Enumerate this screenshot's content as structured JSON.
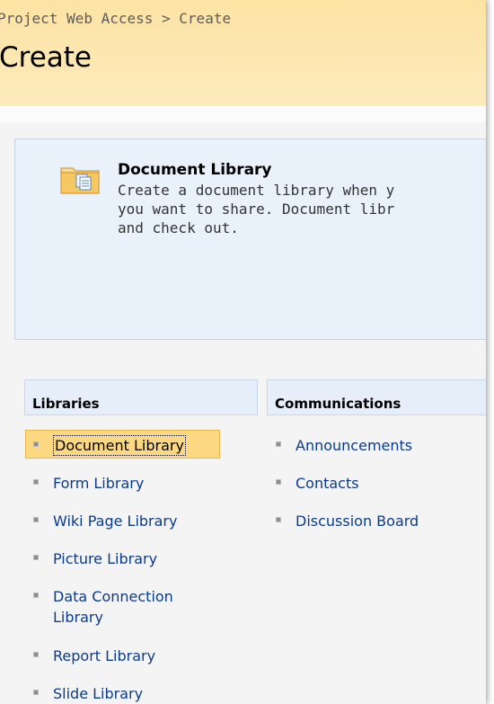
{
  "header": {
    "breadcrumb": "Project Web Access > Create",
    "page_title": "Create"
  },
  "preview": {
    "title": "Document Library",
    "description_lines": [
      "Create a document library when y",
      "you want to share.  Document libr",
      "and check out."
    ],
    "icon": "document-library-folder-icon"
  },
  "categories": {
    "libraries": {
      "label": "Libraries",
      "items": [
        {
          "label": "Document Library",
          "selected": true
        },
        {
          "label": "Form Library"
        },
        {
          "label": "Wiki Page Library"
        },
        {
          "label": "Picture Library"
        },
        {
          "label": "Data Connection",
          "label_line2": "Library"
        },
        {
          "label": "Report Library"
        },
        {
          "label": "Slide Library"
        }
      ]
    },
    "communications": {
      "label": "Communications",
      "items": [
        {
          "label": "Announcements"
        },
        {
          "label": "Contacts"
        },
        {
          "label": "Discussion Board"
        }
      ]
    }
  },
  "colors": {
    "header_gradient": "#fde3a4",
    "link": "#0b3b8c",
    "selected_bg": "#fdd883",
    "preview_bg": "#e9f1fb"
  }
}
